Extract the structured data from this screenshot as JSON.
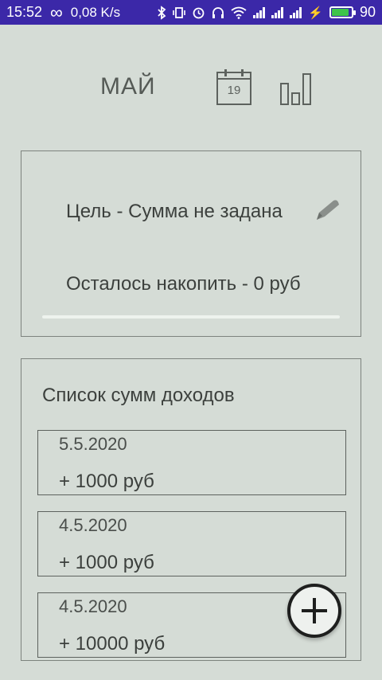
{
  "status_bar": {
    "time": "15:52",
    "infinity": "∞",
    "speed": "0,08 K/s",
    "battery_level": "90",
    "bg_color": "#3b28a8"
  },
  "header": {
    "month": "МАЙ",
    "calendar_day": "19",
    "calendar_icon": "calendar-icon",
    "stats_icon": "bar-chart-icon"
  },
  "goal": {
    "goal_text": "Цель - Сумма не задана",
    "remaining_text": "Осталось накопить - 0 руб",
    "edit_icon": "pencil-icon",
    "progress_fraction": 0
  },
  "income": {
    "title": "Список сумм доходов",
    "items": [
      {
        "date": "5.5.2020",
        "amount": "+ 1000 руб"
      },
      {
        "date": "4.5.2020",
        "amount": "+ 1000 руб"
      },
      {
        "date": "4.5.2020",
        "amount": "+ 10000 руб"
      }
    ]
  },
  "fab": {
    "icon": "plus-icon"
  }
}
